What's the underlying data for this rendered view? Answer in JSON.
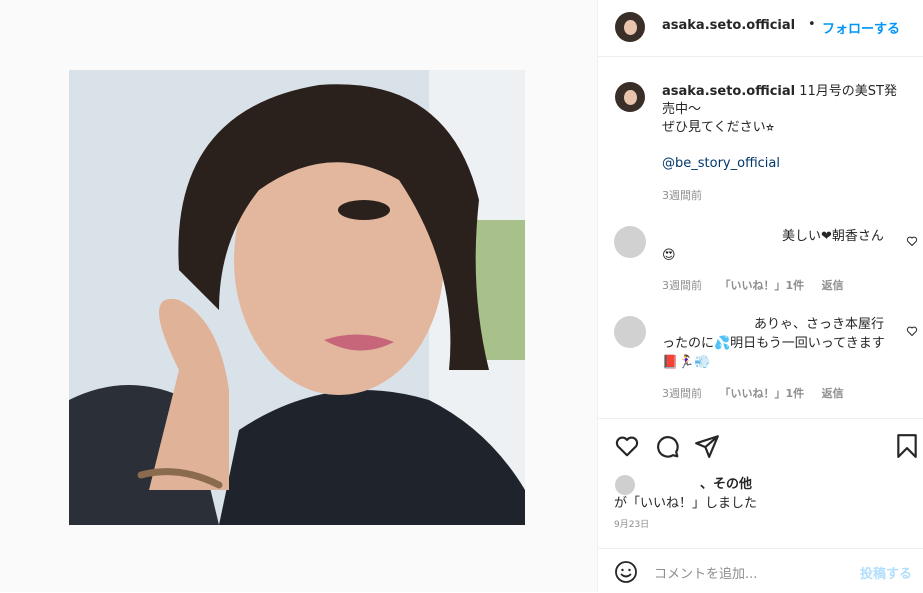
{
  "post": {
    "username": "asaka.seto.official",
    "dot": "•",
    "follow_label": "フォローする"
  },
  "caption": {
    "line1": "11月号の美ST発売中〜",
    "line2": "ぜひ見てください⭐︎",
    "mention": "@be_story_official",
    "time": "3週間前"
  },
  "comments": [
    {
      "text": "美しい❤朝香さん😍",
      "time": "3週間前",
      "likes": "「いいね！」1件",
      "reply": "返信"
    },
    {
      "text": "ありゃ、さっき本屋行ったのに💦明日もう一回いってきます📕🏃‍♀️💨",
      "time": "3週間前",
      "likes": "「いいね！」1件",
      "reply": "返信"
    }
  ],
  "likes_summary": {
    "others": "、その他",
    "suffix": "が「いいね！」しました"
  },
  "date": "9月23日",
  "comment_box": {
    "placeholder": "コメントを追加...",
    "post_label": "投稿する"
  },
  "icons": [
    "heart-icon",
    "comment-icon",
    "share-icon",
    "bookmark-icon",
    "emoji-icon"
  ]
}
